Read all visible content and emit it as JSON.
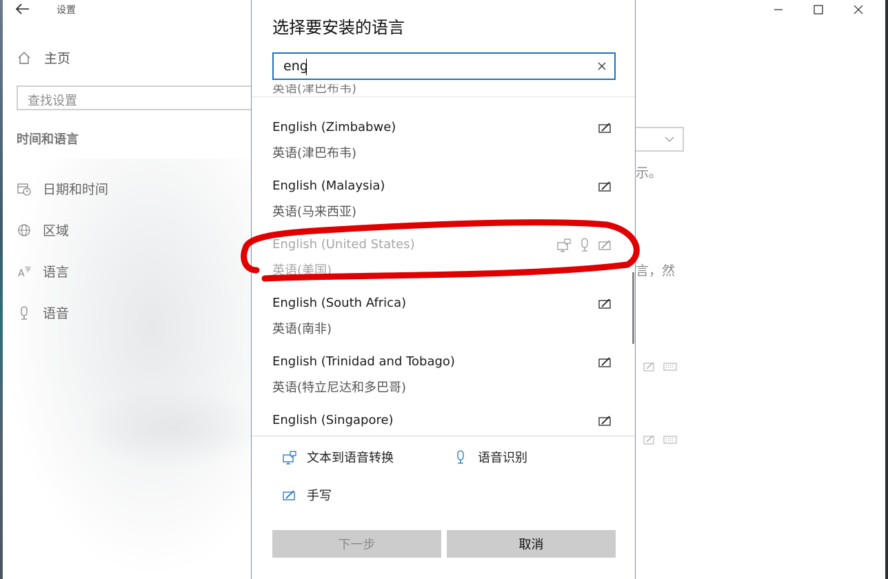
{
  "window": {
    "title": "设置",
    "back_icon": "back-arrow-icon",
    "controls": [
      "minimize-icon",
      "maximize-icon",
      "close-icon"
    ]
  },
  "sidebar": {
    "home_label": "主页",
    "search_placeholder": "查找设置",
    "section_title": "时间和语言",
    "items": [
      {
        "label": "日期和时间",
        "icon": "calendar-clock-icon"
      },
      {
        "label": "区域",
        "icon": "globe-icon"
      },
      {
        "label": "语言",
        "icon": "language-icon"
      },
      {
        "label": "语音",
        "icon": "microphone-icon"
      }
    ]
  },
  "background_fragments": {
    "frag1": "示。",
    "frag2": "言，然"
  },
  "dialog": {
    "title": "选择要安装的语言",
    "search_value": "eng",
    "languages": [
      {
        "en": "English (Zimbabwe)",
        "zh": "英语(津巴布韦)",
        "features": [
          "handwriting"
        ],
        "installed": false
      },
      {
        "en": "English (Malaysia)",
        "zh": "英语(马来西亚)",
        "features": [
          "handwriting"
        ],
        "installed": false
      },
      {
        "en": "English (United States)",
        "zh": "英语(美国)",
        "features": [
          "text-to-speech",
          "speech",
          "handwriting"
        ],
        "installed": true
      },
      {
        "en": "English (South Africa)",
        "zh": "英语(南非)",
        "features": [
          "handwriting"
        ],
        "installed": false
      },
      {
        "en": "English (Trinidad and Tobago)",
        "zh": "英语(特立尼达和多巴哥)",
        "features": [
          "handwriting"
        ],
        "installed": false
      },
      {
        "en": "English (Singapore)",
        "zh": "",
        "features": [
          "handwriting"
        ],
        "installed": false
      }
    ],
    "legend": {
      "tts": "文本到语音转换",
      "speech": "语音识别",
      "handwriting": "手写"
    },
    "buttons": {
      "next": "下一步",
      "cancel": "取消"
    }
  },
  "annotation": {
    "color": "#e00000",
    "target": "English (United States)"
  }
}
